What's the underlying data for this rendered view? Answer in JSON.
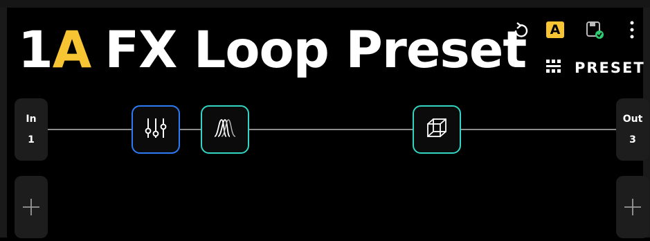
{
  "preset": {
    "number": "1",
    "letter": "A",
    "name": "FX Loop Preset"
  },
  "toolbar": {
    "bank_label": "A",
    "preset_label": "PRESET"
  },
  "chain": {
    "input": {
      "label": "In",
      "value": "1"
    },
    "output": {
      "label": "Out",
      "value": "3"
    },
    "blocks": [
      {
        "icon": "equalizer-sliders-icon",
        "color": "#2d7cf6"
      },
      {
        "icon": "wave-filter-icon",
        "color": "#33d6c3"
      },
      {
        "icon": "cube-icon",
        "color": "#33d6c3"
      }
    ]
  },
  "colors": {
    "accent": "#f7c533",
    "save_ok": "#2ecc71",
    "background": "#000000",
    "panel": "#1d1d1d"
  }
}
